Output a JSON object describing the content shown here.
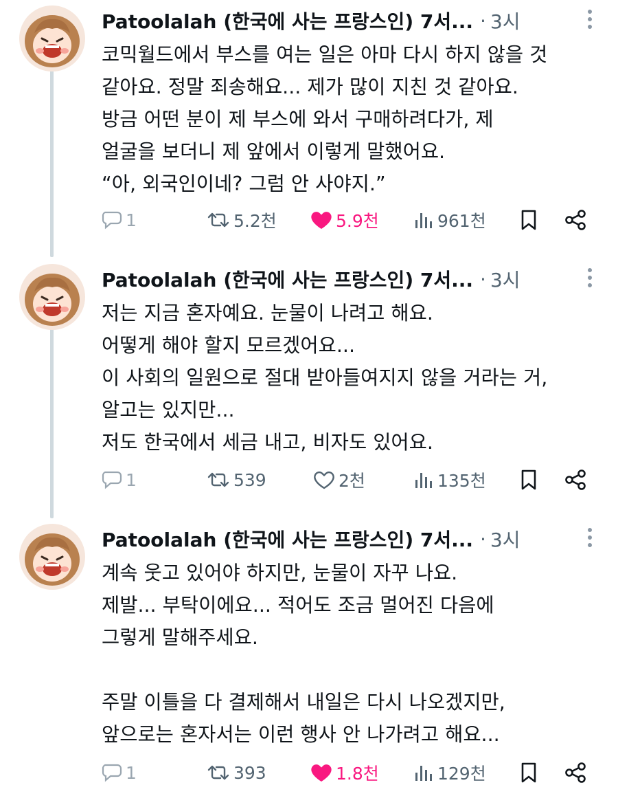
{
  "colors": {
    "like_active": "#f91880",
    "muted": "#536471",
    "thread_line": "#cfd9de"
  },
  "tweets": [
    {
      "author": "Patoolalah (한국에 사는 프랑스인) 7서...",
      "separator": "·",
      "time": "3시",
      "lines": [
        "코믹월드에서 부스를 여는 일은 아마 다시 하지 않을 것",
        "같아요. 정말 죄송해요... 제가 많이 지친 것 같아요.",
        "방금 어떤 분이 제 부스에 와서 구매하려다가, 제",
        "얼굴을 보더니 제 앞에서 이렇게 말했어요.",
        "“아, 외국인이네? 그럼 안 사야지.”"
      ],
      "stats": {
        "replies": "1",
        "retweets": "5.2천",
        "likes": "5.9천",
        "views": "961천"
      },
      "liked": true
    },
    {
      "author": "Patoolalah (한국에 사는 프랑스인) 7서...",
      "separator": "·",
      "time": "3시",
      "lines": [
        "저는 지금 혼자예요. 눈물이 나려고 해요.",
        "어떻게 해야 할지 모르겠어요...",
        "이 사회의 일원으로 절대 받아들여지지 않을 거라는 거,",
        "알고는 있지만...",
        "저도 한국에서 세금 내고, 비자도 있어요."
      ],
      "stats": {
        "replies": "1",
        "retweets": "539",
        "likes": "2천",
        "views": "135천"
      },
      "liked": false
    },
    {
      "author": "Patoolalah (한국에 사는 프랑스인) 7서...",
      "separator": "·",
      "time": "3시",
      "lines": [
        "계속 웃고 있어야 하지만, 눈물이 자꾸 나요.",
        "제발... 부탁이에요... 적어도 조금 멀어진 다음에",
        "그렇게 말해주세요.",
        "",
        "주말 이틀을 다 결제해서 내일은 다시 나오겠지만,",
        "앞으로는 혼자서는 이런 행사 안 나가려고 해요..."
      ],
      "stats": {
        "replies": "1",
        "retweets": "393",
        "likes": "1.8천",
        "views": "129천"
      },
      "liked": true
    }
  ]
}
